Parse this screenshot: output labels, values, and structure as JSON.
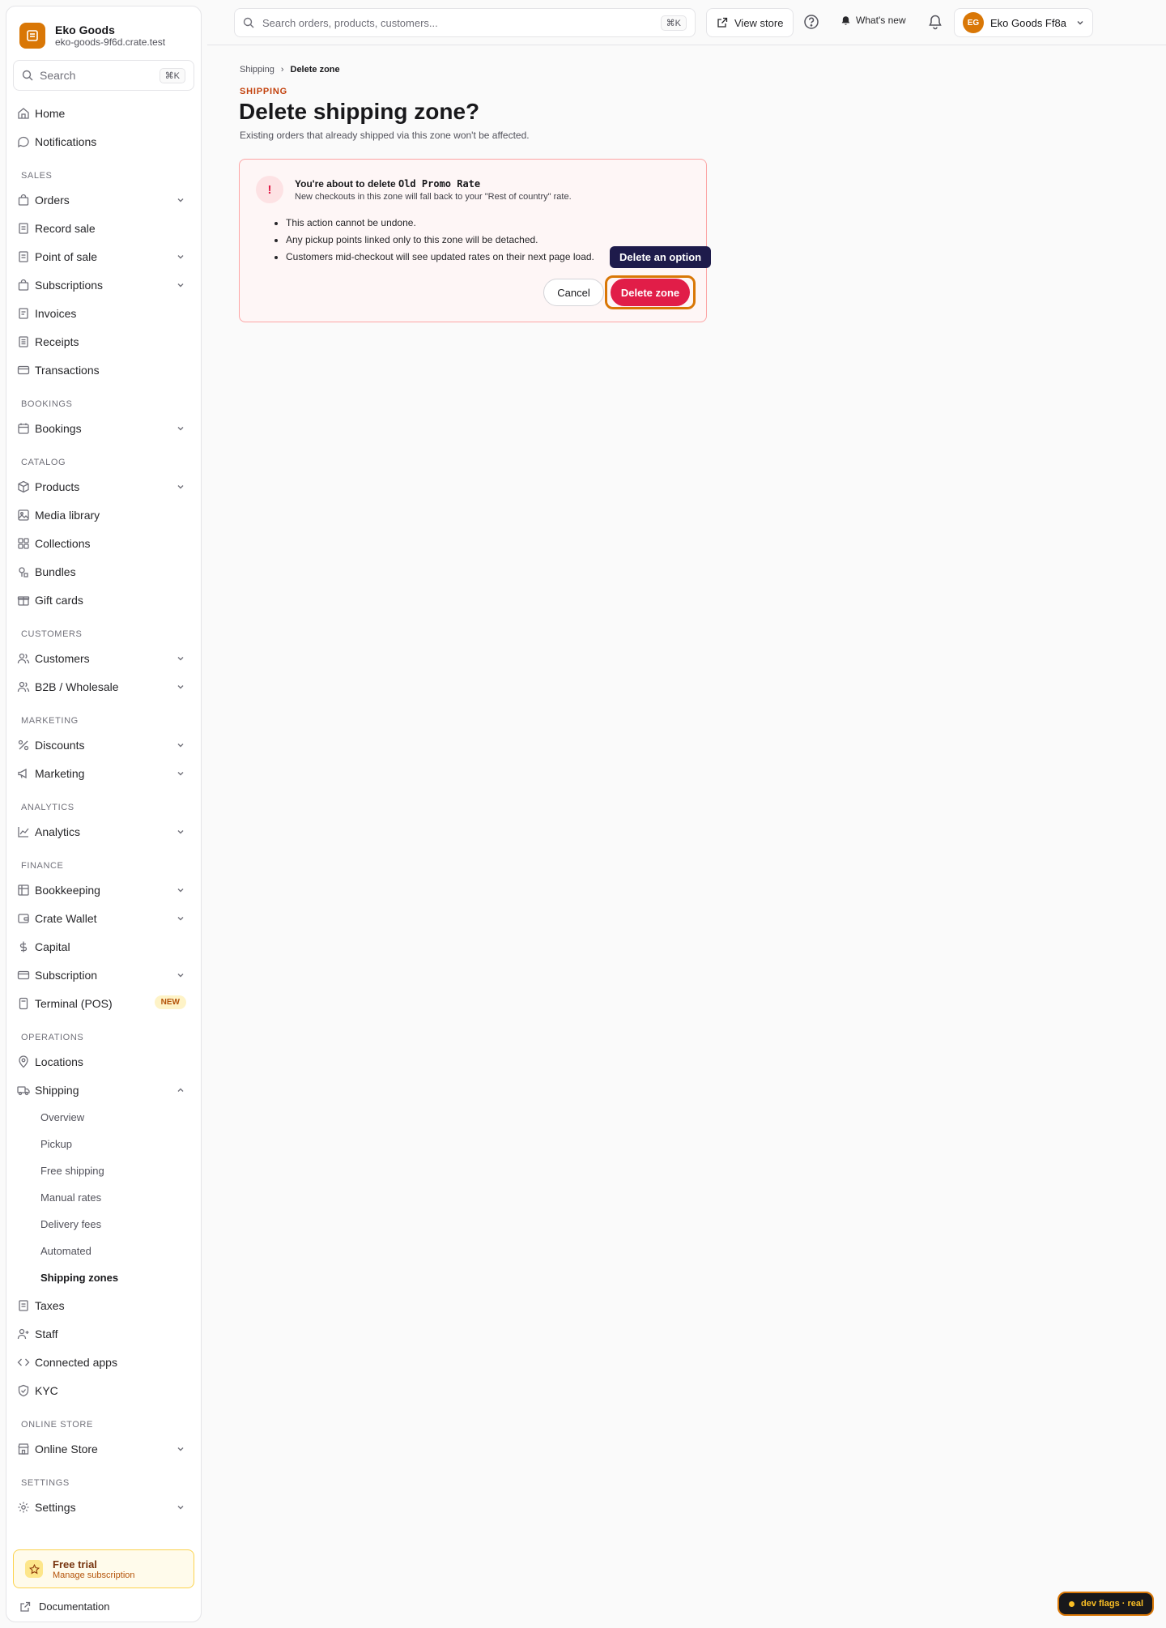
{
  "brand": {
    "name": "Eko Goods",
    "domain": "eko-goods-9f6d.crate.test",
    "accent": "#d97706"
  },
  "sidebar_search": {
    "placeholder": "Search",
    "shortcut": "⌘K"
  },
  "nav": {
    "home": "Home",
    "notifications": "Notifications",
    "sales_section": "SALES",
    "orders": "Orders",
    "record_sale": "Record sale",
    "point_of_sale": "Point of sale",
    "subscriptions": "Subscriptions",
    "invoices": "Invoices",
    "receipts": "Receipts",
    "transactions": "Transactions",
    "bookings_section": "BOOKINGS",
    "bookings": "Bookings",
    "catalog_section": "CATALOG",
    "products": "Products",
    "media_library": "Media library",
    "collections": "Collections",
    "bundles": "Bundles",
    "gift_cards": "Gift cards",
    "customers_section": "CUSTOMERS",
    "customers": "Customers",
    "b2b": "B2B / Wholesale",
    "marketing_section": "MARKETING",
    "discounts": "Discounts",
    "marketing": "Marketing",
    "analytics_section": "ANALYTICS",
    "analytics": "Analytics",
    "finance_section": "FINANCE",
    "bookkeeping": "Bookkeeping",
    "crate_wallet": "Crate Wallet",
    "capital": "Capital",
    "subscription": "Subscription",
    "terminal": "Terminal (POS)",
    "terminal_badge": "NEW",
    "operations_section": "OPERATIONS",
    "locations": "Locations",
    "shipping": "Shipping",
    "shipping_sub": [
      "Overview",
      "Pickup",
      "Free shipping",
      "Manual rates",
      "Delivery fees",
      "Automated",
      "Shipping zones"
    ],
    "taxes": "Taxes",
    "staff": "Staff",
    "connected_apps": "Connected apps",
    "kyc": "KYC",
    "online_store_section": "ONLINE STORE",
    "online_store": "Online Store",
    "settings_section": "SETTINGS",
    "settings": "Settings"
  },
  "trial": {
    "title": "Free trial",
    "subtitle": "Manage subscription"
  },
  "docs": "Documentation",
  "topbar": {
    "search_placeholder": "Search orders, products, customers...",
    "search_shortcut": "⌘K",
    "view_store": "View store",
    "whats_new": "What's new",
    "account_name": "Eko Goods Ff8a",
    "avatar_initials": "EG"
  },
  "breadcrumb": {
    "parent": "Shipping",
    "separator": "›",
    "current": "Delete zone"
  },
  "page": {
    "eyebrow": "SHIPPING",
    "title": "Delete shipping zone?",
    "subtitle": "Existing orders that already shipped via this zone won't be affected."
  },
  "danger": {
    "icon": "!",
    "title_prefix": "You're about to delete",
    "zone_name": "Old Promo Rate",
    "subtitle": "New checkouts in this zone will fall back to your \"Rest of country\" rate.",
    "bullets": [
      "This action cannot be undone.",
      "Any pickup points linked only to this zone will be detached.",
      "Customers mid-checkout will see updated rates on their next page load."
    ],
    "cancel_label": "Cancel",
    "delete_label": "Delete zone",
    "danger_color": "#e11d48"
  },
  "tooltip": "Delete an option",
  "devflags": "dev flags · real"
}
